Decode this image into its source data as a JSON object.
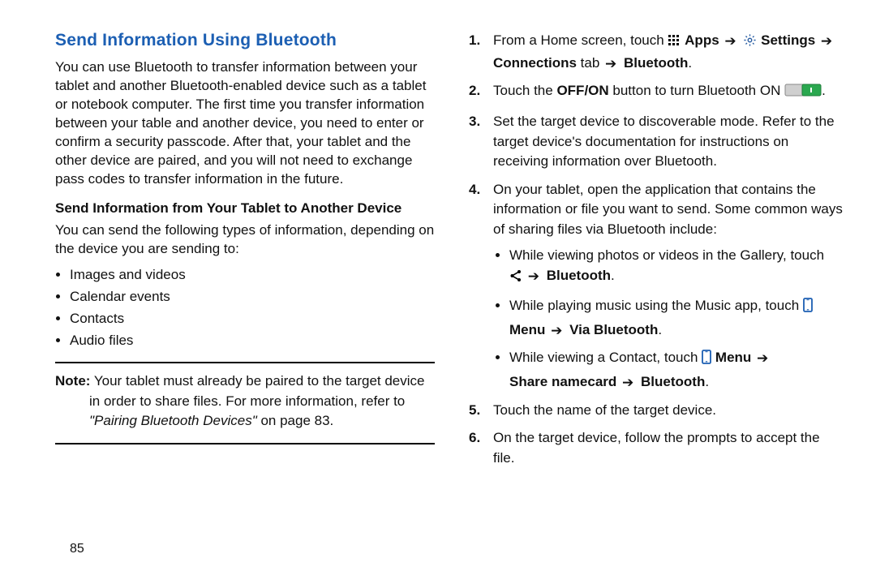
{
  "left": {
    "title": "Send Information Using Bluetooth",
    "intro": "You can use Bluetooth to transfer information between your tablet and another Bluetooth-enabled device such as a tablet or notebook computer. The first time you transfer information between your table and another device, you need to enter or confirm a security passcode. After that, your tablet and the other device are paired, and you will not need to exchange pass codes to transfer information in the future.",
    "subhead": "Send Information from Your Tablet to Another Device",
    "send_intro": "You can send the following types of information, depending on the device you are sending to:",
    "bullets": {
      "b1": "Images and videos",
      "b2": "Calendar events",
      "b3": "Contacts",
      "b4": "Audio files"
    },
    "note": {
      "label": "Note:",
      "line1_after_label": " Your tablet must already be paired to the target device",
      "line2": "in order to share files. For more information, refer to",
      "cite": "\"Pairing Bluetooth Devices\"",
      "after_cite": " on page 83."
    },
    "page_num": "85"
  },
  "right": {
    "steps": {
      "s1": {
        "pre": "From a Home screen, touch ",
        "apps": "Apps",
        "settings": "Settings",
        "conn_tab": "Connections",
        "tab_word": " tab ",
        "bt": "Bluetooth",
        "period": "."
      },
      "s2": {
        "pre": "Touch the ",
        "offon": "OFF/ON",
        "mid": " button to turn Bluetooth ON ",
        "period": "."
      },
      "s3": "Set the target device to discoverable mode. Refer to the target device's documentation for instructions on receiving information over Bluetooth.",
      "s4": {
        "main": "On your tablet, open the application that contains the information or file you want to send. Some common ways of sharing files via Bluetooth include:",
        "sub1_a": "While viewing photos or videos in the Gallery, touch ",
        "sub1_bt": "Bluetooth",
        "sub1_period": ".",
        "sub2_a": "While playing music using the Music app, touch ",
        "sub2_menu": "Menu",
        "sub2_via": "Via Bluetooth",
        "sub2_period": ".",
        "sub3_a": "While viewing a Contact, touch ",
        "sub3_menu": "Menu",
        "sub3_share": "Share namecard",
        "sub3_bt": "Bluetooth",
        "sub3_period": "."
      },
      "s5": "Touch the name of the target device.",
      "s6": "On the target device, follow the prompts to accept the file."
    }
  },
  "arrow_glyph": "➔"
}
